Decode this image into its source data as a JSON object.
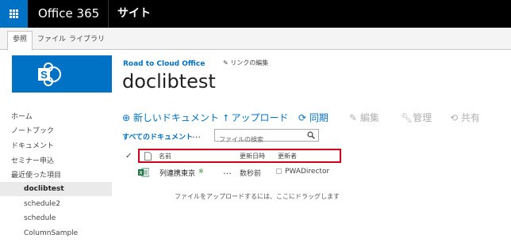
{
  "suite_bar": {
    "title": "Office 365",
    "site_label": "サイト",
    "colors": {
      "bar": "#000000",
      "waffle": "#0072c6"
    }
  },
  "ribbon": {
    "tabs": [
      "参照",
      "ファイル",
      "ライブラリ"
    ],
    "active_tab": "参照"
  },
  "logo": {
    "icon": "sharepoint-logo-icon",
    "color": "#0072c6"
  },
  "left_nav": {
    "items": [
      "ホーム",
      "ノートブック",
      "ドキュメント",
      "セミナー申込",
      "最近使った項目"
    ],
    "recent_items": [
      "doclibtest",
      "schedule2",
      "schedule",
      "ColumnSample"
    ],
    "selected": "doclibtest"
  },
  "header": {
    "breadcrumb": "Road to Cloud Office",
    "edit_links": "リンクの編集",
    "page_title": "doclibtest"
  },
  "command_bar": {
    "new_document": "新しいドキュメント",
    "upload": "アップロード",
    "sync": "同期",
    "edit": "編集",
    "manage": "管理",
    "share": "共有"
  },
  "view_bar": {
    "all_documents": "すべてのドキュメント",
    "more": "…",
    "search_placeholder": "ファイルの検索"
  },
  "list": {
    "check_mark": "✓",
    "columns": [
      "名前",
      "更新日時",
      "更新者"
    ],
    "rows": [
      {
        "name": "列連携東京",
        "new_marker": "※",
        "more": "…",
        "modified": "数秒前",
        "modified_by": "PWADirector"
      }
    ],
    "drop_hint": "ファイルをアップロードするには、ここにドラッグします"
  },
  "accent_color": "#0072c6",
  "highlight_color": "#d0021b"
}
